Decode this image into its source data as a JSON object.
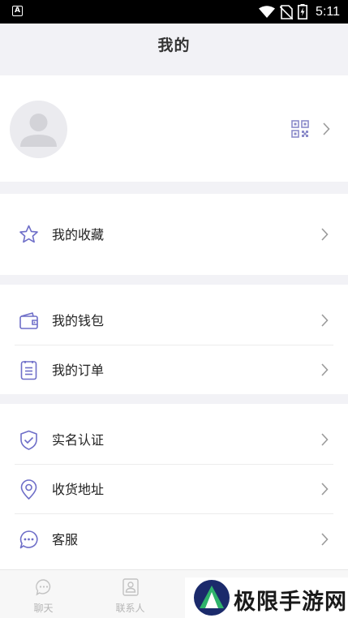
{
  "status_bar": {
    "time": "5:11"
  },
  "header": {
    "title": "我的"
  },
  "profile": {},
  "groups": [
    [
      {
        "label": "我的收藏",
        "icon": "star-icon"
      }
    ],
    [
      {
        "label": "我的钱包",
        "icon": "wallet-icon"
      },
      {
        "label": "我的订单",
        "icon": "order-list-icon"
      }
    ],
    [
      {
        "label": "实名认证",
        "icon": "shield-check-icon"
      },
      {
        "label": "收货地址",
        "icon": "location-pin-icon"
      },
      {
        "label": "客服",
        "icon": "chat-bubble-icon"
      }
    ]
  ],
  "tabs": [
    {
      "label": "聊天",
      "icon": "chat-icon"
    },
    {
      "label": "联系人",
      "icon": "contacts-icon"
    }
  ],
  "watermark": {
    "text": "极限手游网"
  },
  "colors": {
    "accent_icon": "#6e6ec8",
    "background": "#f2f2f6",
    "tab_inactive": "#b5b5b5"
  }
}
